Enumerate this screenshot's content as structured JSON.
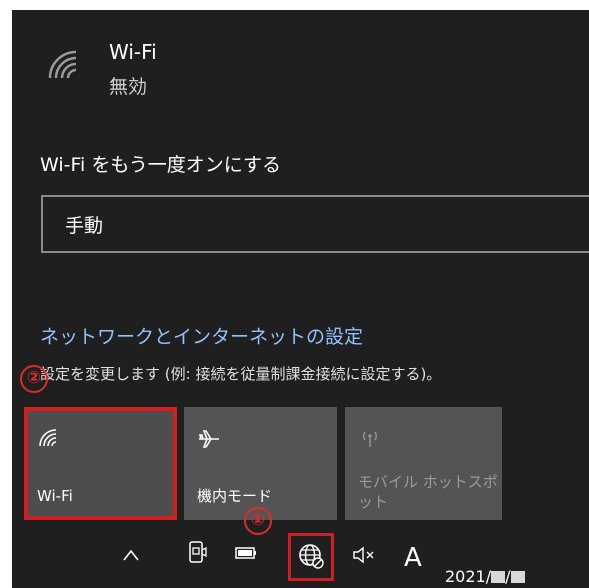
{
  "wifi": {
    "title": "Wi-Fi",
    "status": "無効"
  },
  "reenable": {
    "label": "Wi-Fi をもう一度オンにする",
    "selected": "手動"
  },
  "settings": {
    "link": "ネットワークとインターネットの設定",
    "description": "設定を変更します (例: 接続を従量制課金接続に設定する)。"
  },
  "tiles": [
    {
      "label": "Wi-Fi",
      "icon": "wifi-icon"
    },
    {
      "label": "機内モード",
      "icon": "airplane-icon"
    },
    {
      "label": "モバイル ホットスポット",
      "icon": "hotspot-icon"
    }
  ],
  "annotations": {
    "step1": "①",
    "step2": "②"
  },
  "taskbar": {
    "ime": "A",
    "clock_prefix": "2021/",
    "clock_sep": "/"
  },
  "colors": {
    "panel_bg": "#1f1f1f",
    "link": "#8fc2ff",
    "highlight": "#d21f1f"
  }
}
